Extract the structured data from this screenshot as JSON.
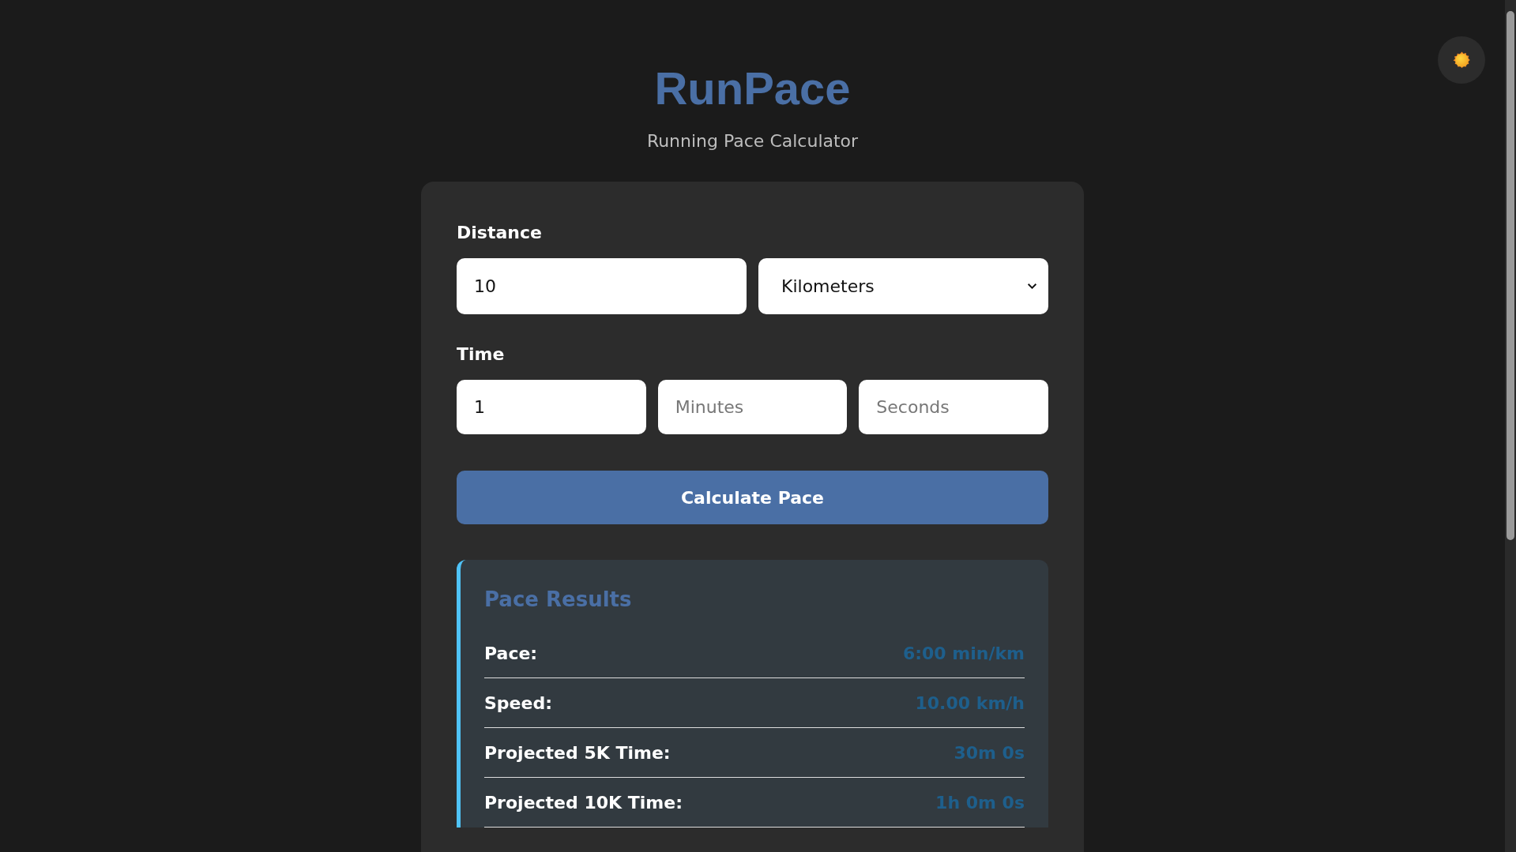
{
  "app": {
    "title": "RunPace",
    "subtitle": "Running Pace Calculator"
  },
  "theme_toggle": {
    "kind": "sun"
  },
  "distance": {
    "label": "Distance",
    "value": "10",
    "unit": "Kilometers"
  },
  "time": {
    "label": "Time",
    "fields": [
      {
        "value": "1"
      },
      {
        "placeholder": "Minutes"
      },
      {
        "placeholder": "Seconds"
      }
    ]
  },
  "calculate_button": "Calculate Pace",
  "results": {
    "title": "Pace Results",
    "rows": [
      {
        "label": "Pace:",
        "value": "6:00 min/km"
      },
      {
        "label": "Speed:",
        "value": "10.00 km/h"
      },
      {
        "label": "Projected 5K Time:",
        "value": "30m 0s"
      },
      {
        "label": "Projected 10K Time:",
        "value": "1h 0m 0s"
      }
    ]
  }
}
